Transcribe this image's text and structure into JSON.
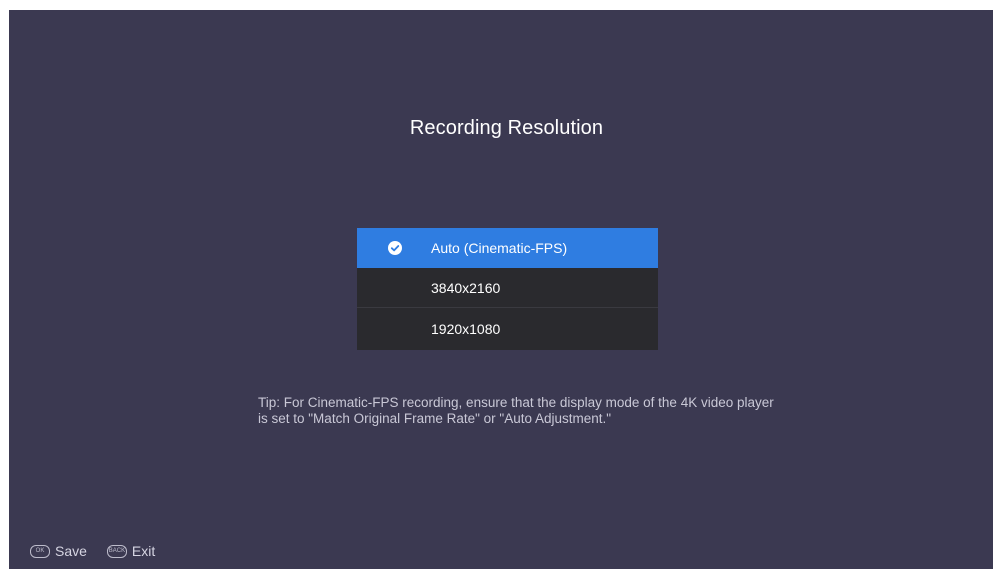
{
  "title": "Recording Resolution",
  "options": [
    {
      "label": "Auto (Cinematic-FPS)",
      "selected": true
    },
    {
      "label": "3840x2160",
      "selected": false
    },
    {
      "label": "1920x1080",
      "selected": false
    }
  ],
  "tip": "Tip: For Cinematic-FPS recording, ensure that the display mode of the 4K video player is set to \"Match Original Frame Rate\" or \"Auto Adjustment.\"",
  "footer": {
    "save": {
      "key": "OK",
      "label": "Save"
    },
    "exit": {
      "key": "BACK",
      "label": "Exit"
    }
  },
  "colors": {
    "background": "#3b3951",
    "selected": "#2f7de1",
    "option": "#2a2a2e"
  },
  "icons": {
    "selected_indicator": "check-circle-icon"
  }
}
